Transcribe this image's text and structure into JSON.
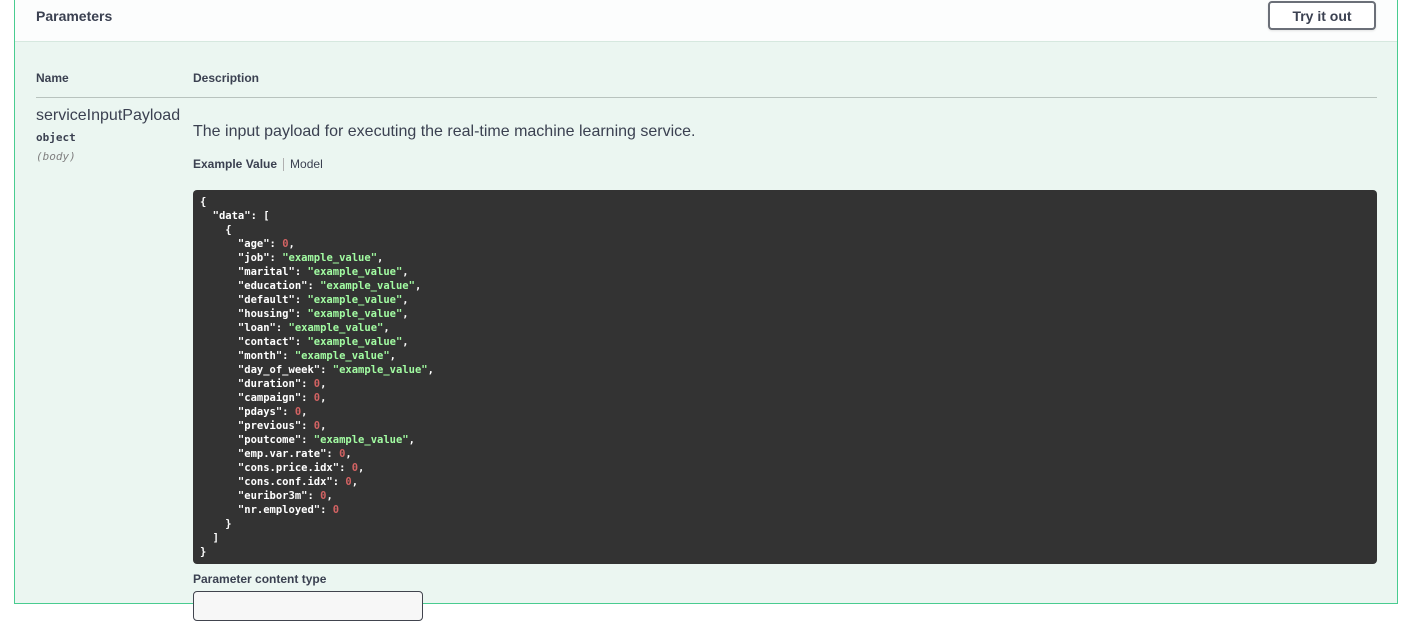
{
  "section": {
    "title": "Parameters",
    "try_button": "Try it out"
  },
  "table": {
    "col_name": "Name",
    "col_description": "Description"
  },
  "param": {
    "name": "serviceInputPayload",
    "type": "object",
    "in": "(body)",
    "description": "The input payload for executing the real-time machine learning service."
  },
  "tabs": {
    "active": "Example Value",
    "other": "Model"
  },
  "example": {
    "lines": [
      [
        {
          "t": "p",
          "v": "{"
        }
      ],
      [
        {
          "t": "p",
          "v": "  \"data\": ["
        }
      ],
      [
        {
          "t": "p",
          "v": "    {"
        }
      ],
      [
        {
          "t": "p",
          "v": "      \"age\": "
        },
        {
          "t": "n",
          "v": "0"
        },
        {
          "t": "p",
          "v": ","
        }
      ],
      [
        {
          "t": "p",
          "v": "      \"job\": "
        },
        {
          "t": "s",
          "v": "\"example_value\""
        },
        {
          "t": "p",
          "v": ","
        }
      ],
      [
        {
          "t": "p",
          "v": "      \"marital\": "
        },
        {
          "t": "s",
          "v": "\"example_value\""
        },
        {
          "t": "p",
          "v": ","
        }
      ],
      [
        {
          "t": "p",
          "v": "      \"education\": "
        },
        {
          "t": "s",
          "v": "\"example_value\""
        },
        {
          "t": "p",
          "v": ","
        }
      ],
      [
        {
          "t": "p",
          "v": "      \"default\": "
        },
        {
          "t": "s",
          "v": "\"example_value\""
        },
        {
          "t": "p",
          "v": ","
        }
      ],
      [
        {
          "t": "p",
          "v": "      \"housing\": "
        },
        {
          "t": "s",
          "v": "\"example_value\""
        },
        {
          "t": "p",
          "v": ","
        }
      ],
      [
        {
          "t": "p",
          "v": "      \"loan\": "
        },
        {
          "t": "s",
          "v": "\"example_value\""
        },
        {
          "t": "p",
          "v": ","
        }
      ],
      [
        {
          "t": "p",
          "v": "      \"contact\": "
        },
        {
          "t": "s",
          "v": "\"example_value\""
        },
        {
          "t": "p",
          "v": ","
        }
      ],
      [
        {
          "t": "p",
          "v": "      \"month\": "
        },
        {
          "t": "s",
          "v": "\"example_value\""
        },
        {
          "t": "p",
          "v": ","
        }
      ],
      [
        {
          "t": "p",
          "v": "      \"day_of_week\": "
        },
        {
          "t": "s",
          "v": "\"example_value\""
        },
        {
          "t": "p",
          "v": ","
        }
      ],
      [
        {
          "t": "p",
          "v": "      \"duration\": "
        },
        {
          "t": "n",
          "v": "0"
        },
        {
          "t": "p",
          "v": ","
        }
      ],
      [
        {
          "t": "p",
          "v": "      \"campaign\": "
        },
        {
          "t": "n",
          "v": "0"
        },
        {
          "t": "p",
          "v": ","
        }
      ],
      [
        {
          "t": "p",
          "v": "      \"pdays\": "
        },
        {
          "t": "n",
          "v": "0"
        },
        {
          "t": "p",
          "v": ","
        }
      ],
      [
        {
          "t": "p",
          "v": "      \"previous\": "
        },
        {
          "t": "n",
          "v": "0"
        },
        {
          "t": "p",
          "v": ","
        }
      ],
      [
        {
          "t": "p",
          "v": "      \"poutcome\": "
        },
        {
          "t": "s",
          "v": "\"example_value\""
        },
        {
          "t": "p",
          "v": ","
        }
      ],
      [
        {
          "t": "p",
          "v": "      \"emp.var.rate\": "
        },
        {
          "t": "n",
          "v": "0"
        },
        {
          "t": "p",
          "v": ","
        }
      ],
      [
        {
          "t": "p",
          "v": "      \"cons.price.idx\": "
        },
        {
          "t": "n",
          "v": "0"
        },
        {
          "t": "p",
          "v": ","
        }
      ],
      [
        {
          "t": "p",
          "v": "      \"cons.conf.idx\": "
        },
        {
          "t": "n",
          "v": "0"
        },
        {
          "t": "p",
          "v": ","
        }
      ],
      [
        {
          "t": "p",
          "v": "      \"euribor3m\": "
        },
        {
          "t": "n",
          "v": "0"
        },
        {
          "t": "p",
          "v": ","
        }
      ],
      [
        {
          "t": "p",
          "v": "      \"nr.employed\": "
        },
        {
          "t": "n",
          "v": "0"
        }
      ],
      [
        {
          "t": "p",
          "v": "    }"
        }
      ],
      [
        {
          "t": "p",
          "v": "  ]"
        }
      ],
      [
        {
          "t": "p",
          "v": "}"
        }
      ]
    ]
  },
  "content_type": {
    "label": "Parameter content type",
    "value": ""
  },
  "colors": {
    "panel_border": "#49cc90",
    "panel_bg": "#ebf6f1",
    "code_bg": "#333333",
    "string": "#a2fca2",
    "number": "#d36363"
  }
}
